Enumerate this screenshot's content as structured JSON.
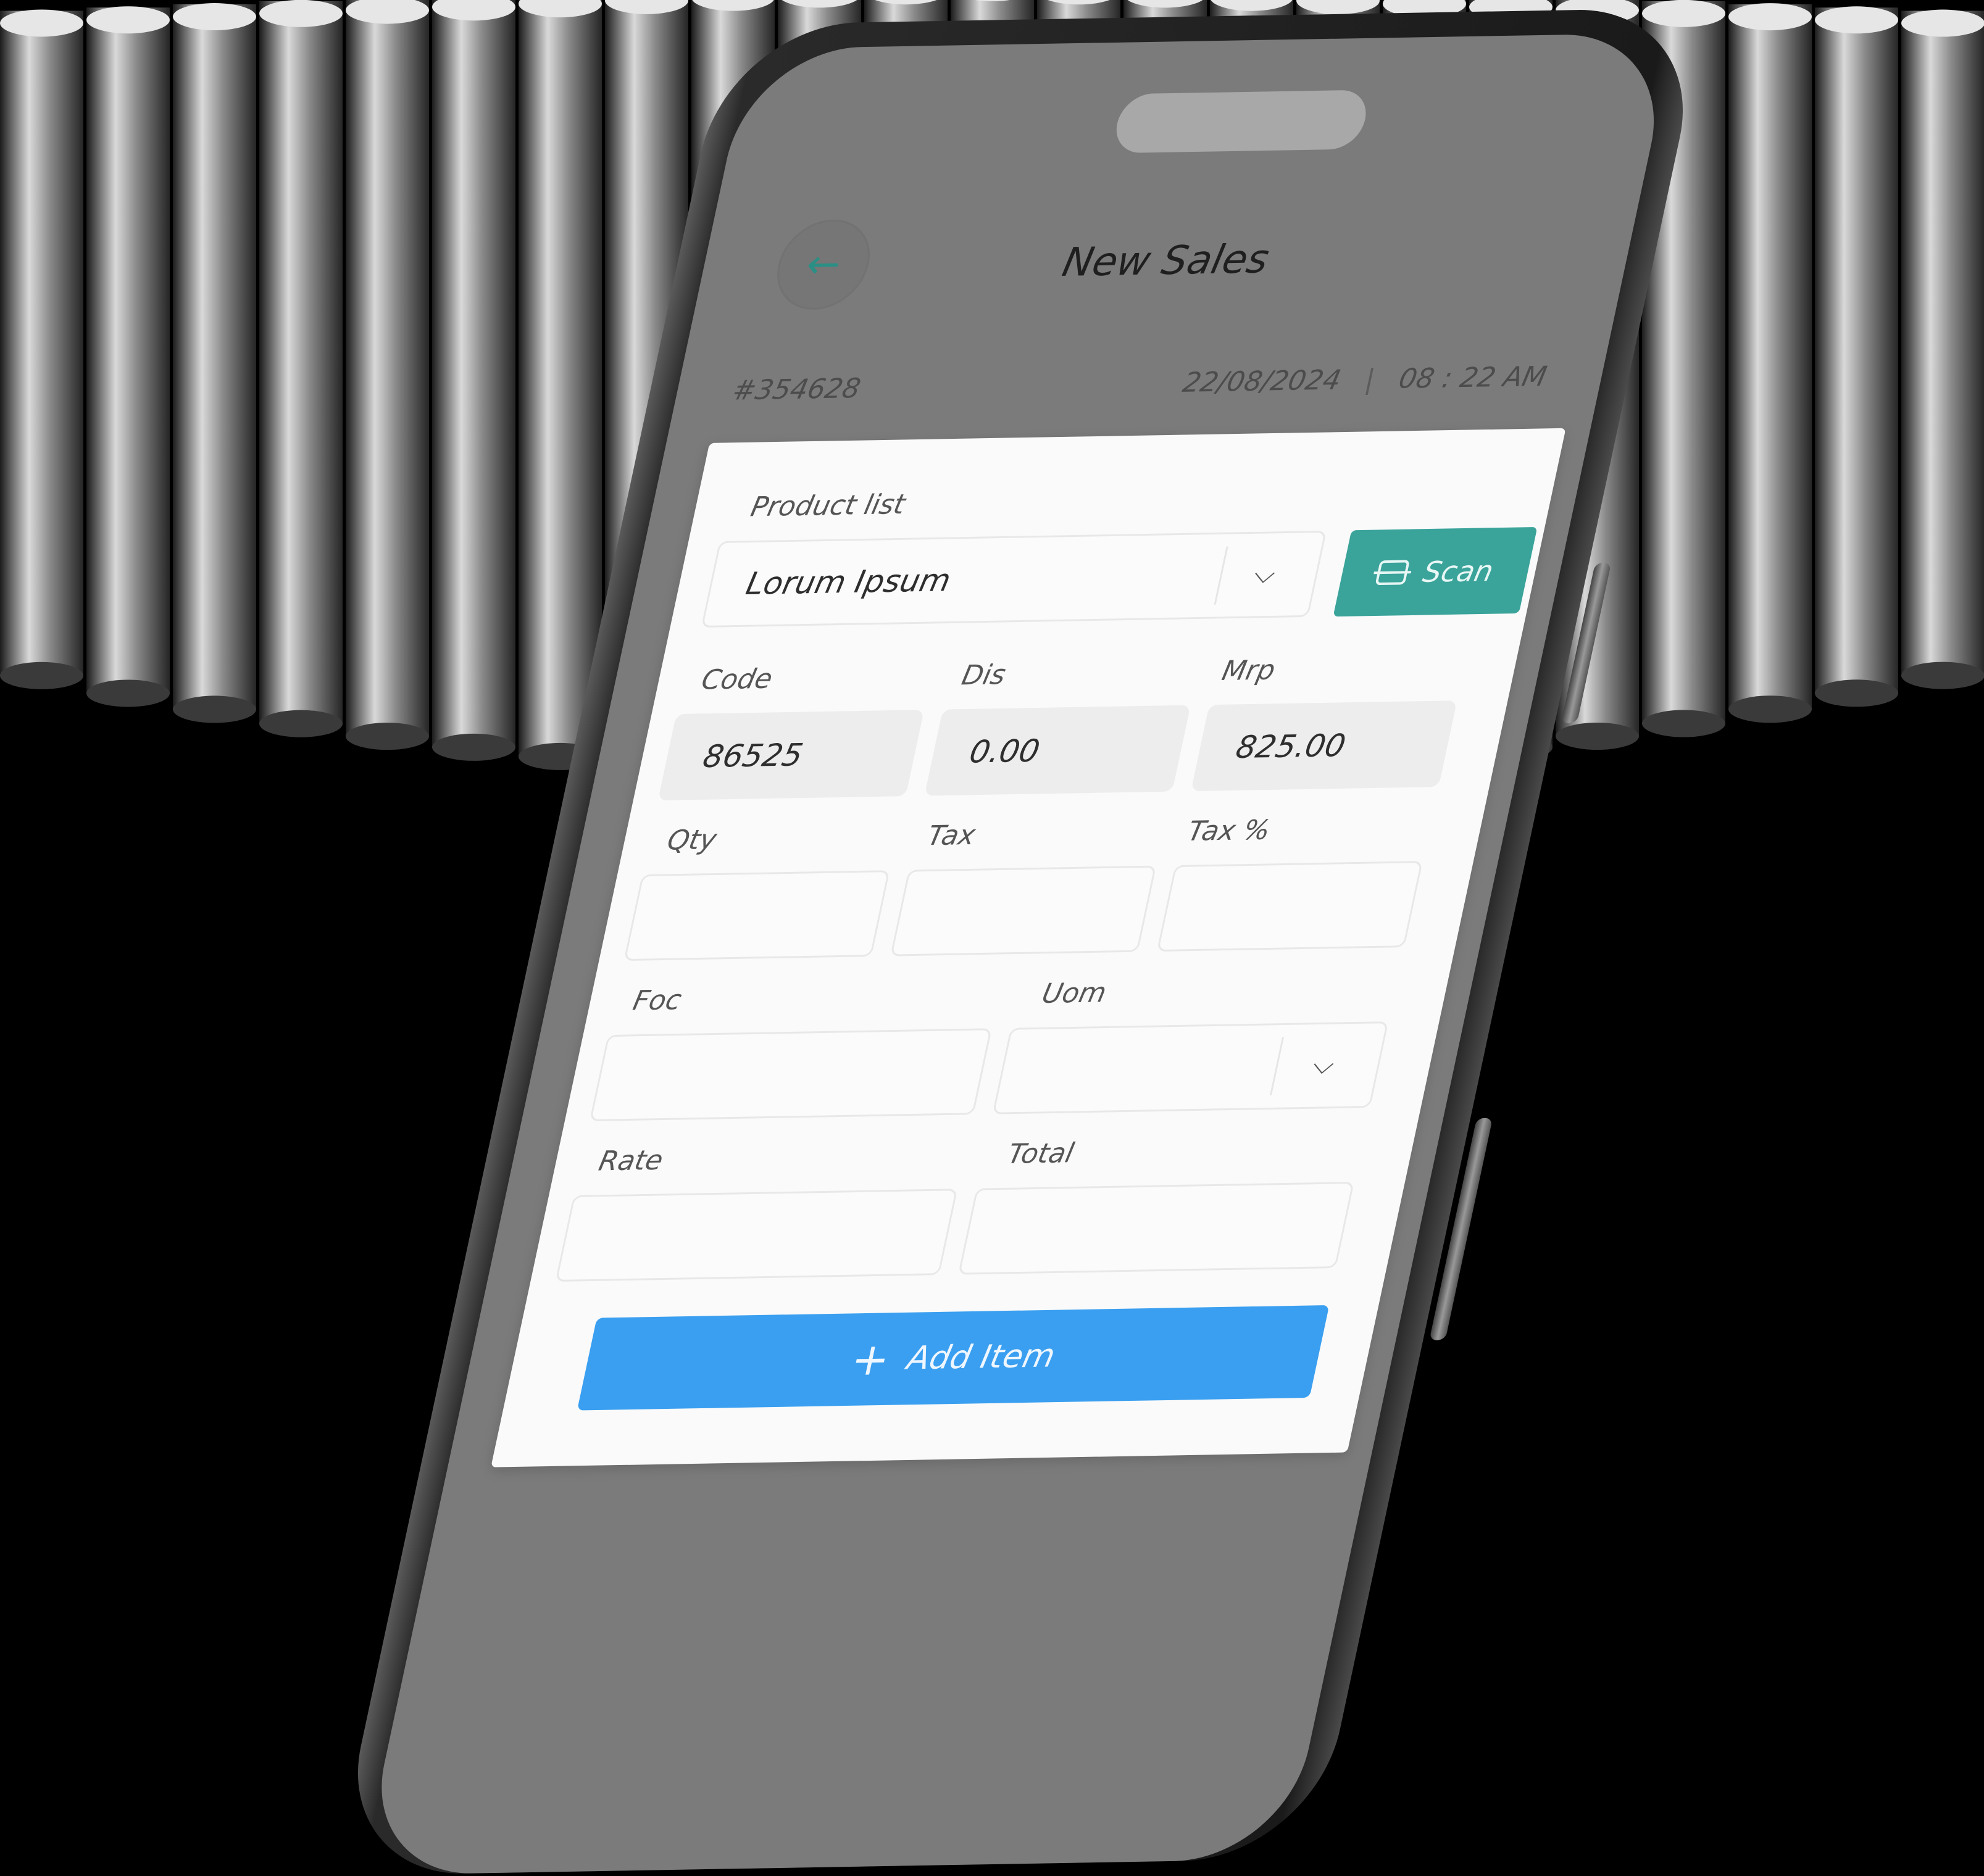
{
  "header": {
    "title": "New Sales",
    "back_icon": "←"
  },
  "order": {
    "number": "#354628",
    "date": "22/08/2024",
    "separator": "|",
    "time": "08 : 22 AM"
  },
  "form": {
    "product_list": {
      "label": "Product list",
      "value": "Lorum Ipsum",
      "chevron": "⌵"
    },
    "scan_button": {
      "label": "Scan",
      "icon": "scan-icon"
    },
    "code": {
      "label": "Code",
      "value": "86525"
    },
    "dis": {
      "label": "Dis",
      "value": "0.00"
    },
    "mrp": {
      "label": "Mrp",
      "value": "825.00"
    },
    "qty": {
      "label": "Qty",
      "value": ""
    },
    "tax": {
      "label": "Tax",
      "value": ""
    },
    "tax_pct": {
      "label": "Tax %",
      "value": ""
    },
    "foc": {
      "label": "Foc",
      "value": ""
    },
    "uom": {
      "label": "Uom",
      "value": "",
      "chevron": "⌵"
    },
    "rate": {
      "label": "Rate",
      "value": ""
    },
    "total": {
      "label": "Total",
      "value": ""
    },
    "add_button": {
      "label": "Add Item",
      "icon": "+"
    }
  },
  "colors": {
    "accent_teal": "#3aa39a",
    "primary_blue": "#3a9ff0",
    "screen_bg": "#7b7b7b"
  }
}
